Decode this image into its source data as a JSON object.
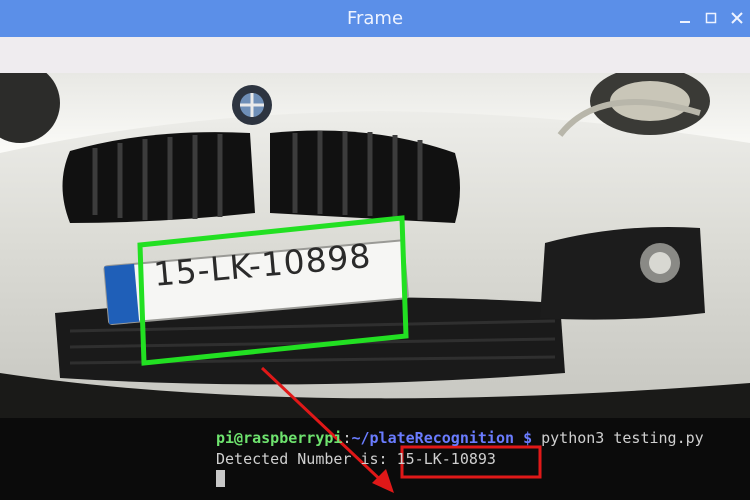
{
  "window": {
    "title": "Frame"
  },
  "plate": {
    "text": "15-LK-10898"
  },
  "terminal": {
    "user_host": "pi@raspberrypi",
    "sep": ":",
    "path": "~/plateRecognition",
    "dollar": "$",
    "command": " python3 testing.py",
    "result_label": "Detected Number is: ",
    "result_value": "15-LK-10893"
  },
  "colors": {
    "titlebar": "#5b8fe8",
    "detection_box": "#22e022",
    "annotation": "#e01818"
  }
}
